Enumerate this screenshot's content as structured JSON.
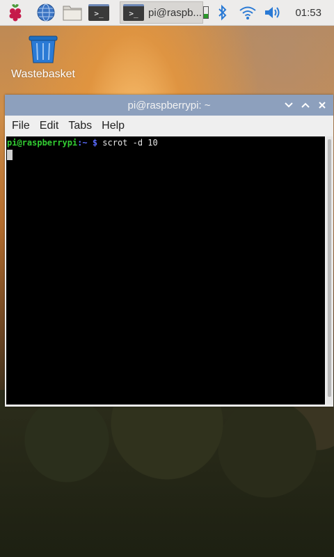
{
  "taskbar": {
    "task_label": "pi@raspb...",
    "clock": "01:53",
    "terminal_glyph": ">_"
  },
  "desktop": {
    "wastebasket_label": "Wastebasket"
  },
  "window": {
    "title": "pi@raspberrypi: ~",
    "menu": [
      "File",
      "Edit",
      "Tabs",
      "Help"
    ],
    "terminal": {
      "prompt_user": "pi@raspberrypi",
      "prompt_path": ":~ $",
      "command": " scrot -d 10"
    }
  },
  "colors": {
    "titlebar": "#8da0bd",
    "prompt_user": "#32cd32",
    "prompt_path": "#5a6cff"
  }
}
